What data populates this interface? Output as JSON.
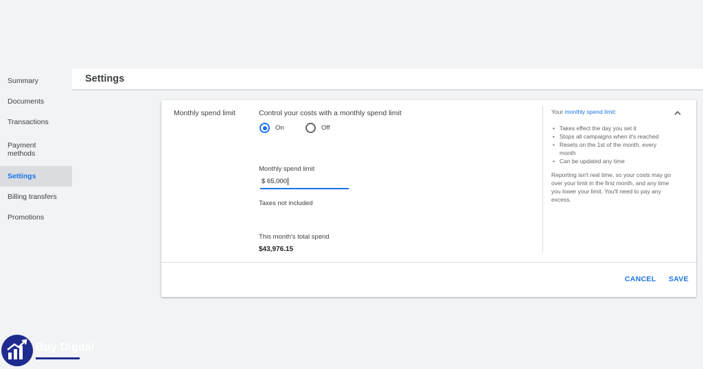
{
  "sidebar": {
    "items": [
      {
        "label": "Summary",
        "active": false
      },
      {
        "label": "Documents",
        "active": false
      },
      {
        "label": "Transactions",
        "active": false
      },
      {
        "label": "Payment methods",
        "active": false
      },
      {
        "label": "Settings",
        "active": true
      },
      {
        "label": "Billing transfers",
        "active": false
      },
      {
        "label": "Promotions",
        "active": false
      }
    ]
  },
  "header": {
    "title": "Settings"
  },
  "card": {
    "section_label": "Monthly spend limit",
    "control_title": "Control your costs with a monthly spend limit",
    "radios": [
      {
        "label": "On",
        "checked": true
      },
      {
        "label": "Off",
        "checked": false
      }
    ],
    "field_label": "Monthly spend limit",
    "field_value": "$ 65,000",
    "taxes_note": "Taxes not included",
    "spend_label": "This month's total spend",
    "spend_value": "$43,976.15",
    "info": {
      "intro_prefix": "Your ",
      "intro_link": "monthly spend limit",
      "intro_suffix": ":",
      "bullets": [
        "Takes effect the day you set it",
        "Stops all campaigns when it's reached",
        "Resets on the 1st of the month, every month",
        "Can be updated any time"
      ],
      "note": "Reporting isn't real time, so your costs may go over your limit in the first month, and any time you lower your limit. You'll need to pay any excess."
    },
    "collapse_icon": "chevron-up-icon",
    "cancel_label": "CANCEL",
    "save_label": "SAVE"
  },
  "watermark": {
    "text": "Buy Digital",
    "icon": "growth-chart-icon"
  },
  "colors": {
    "accent": "#1a73e8",
    "background": "#f1f3f4",
    "active_nav_bg": "#dadce0",
    "logo_blue": "#1e2b8f"
  }
}
